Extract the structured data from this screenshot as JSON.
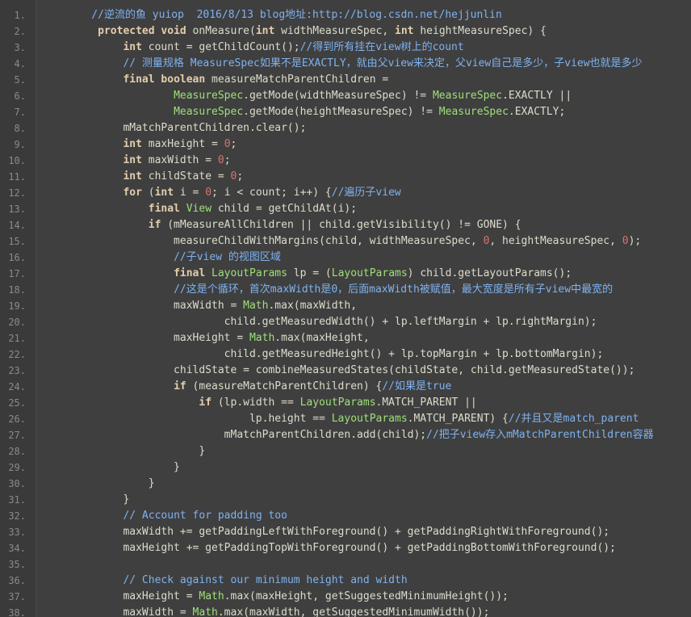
{
  "colors": {
    "background": "#3f3f3f",
    "gutter": "#3a3a3a",
    "line_number": "#8a8a8a",
    "plain": "#dcdccc",
    "keyword": "#e3ceab",
    "comment": "#7fb2ef",
    "type": "#9fe07a",
    "number": "#d5736f"
  },
  "lines": [
    {
      "n": "1.",
      "tokens": [
        [
          "cm",
          "    //逆流的鱼 yuiop  2016/8/13 blog地址:http://blog.csdn.net/hejjunlin"
        ]
      ]
    },
    {
      "n": "2.",
      "tokens": [
        [
          "pl",
          "     "
        ],
        [
          "kw",
          "protected"
        ],
        [
          "pl",
          " "
        ],
        [
          "kw",
          "void"
        ],
        [
          "pl",
          " onMeasure("
        ],
        [
          "kw",
          "int"
        ],
        [
          "pl",
          " widthMeasureSpec, "
        ],
        [
          "kw",
          "int"
        ],
        [
          "pl",
          " heightMeasureSpec) {"
        ]
      ]
    },
    {
      "n": "3.",
      "tokens": [
        [
          "pl",
          "         "
        ],
        [
          "kw",
          "int"
        ],
        [
          "pl",
          " count = getChildCount();"
        ],
        [
          "cm",
          "//得到所有挂在view树上的count"
        ]
      ]
    },
    {
      "n": "4.",
      "tokens": [
        [
          "pl",
          "         "
        ],
        [
          "cm",
          "// 测量规格 MeasureSpec如果不是EXACTLY，就由父view来决定，父view自己是多少，子view也就是多少"
        ]
      ]
    },
    {
      "n": "5.",
      "tokens": [
        [
          "pl",
          "         "
        ],
        [
          "kw",
          "final"
        ],
        [
          "pl",
          " "
        ],
        [
          "kw",
          "boolean"
        ],
        [
          "pl",
          " measureMatchParentChildren ="
        ]
      ]
    },
    {
      "n": "6.",
      "tokens": [
        [
          "pl",
          "                 "
        ],
        [
          "ty",
          "MeasureSpec"
        ],
        [
          "pl",
          ".getMode(widthMeasureSpec) != "
        ],
        [
          "ty",
          "MeasureSpec"
        ],
        [
          "pl",
          ".EXACTLY ||"
        ]
      ]
    },
    {
      "n": "7.",
      "tokens": [
        [
          "pl",
          "                 "
        ],
        [
          "ty",
          "MeasureSpec"
        ],
        [
          "pl",
          ".getMode(heightMeasureSpec) != "
        ],
        [
          "ty",
          "MeasureSpec"
        ],
        [
          "pl",
          ".EXACTLY;"
        ]
      ]
    },
    {
      "n": "8.",
      "tokens": [
        [
          "pl",
          "         mMatchParentChildren.clear();"
        ]
      ]
    },
    {
      "n": "9.",
      "tokens": [
        [
          "pl",
          "         "
        ],
        [
          "kw",
          "int"
        ],
        [
          "pl",
          " maxHeight = "
        ],
        [
          "num",
          "0"
        ],
        [
          "pl",
          ";"
        ]
      ]
    },
    {
      "n": "10.",
      "tokens": [
        [
          "pl",
          "         "
        ],
        [
          "kw",
          "int"
        ],
        [
          "pl",
          " maxWidth = "
        ],
        [
          "num",
          "0"
        ],
        [
          "pl",
          ";"
        ]
      ]
    },
    {
      "n": "11.",
      "tokens": [
        [
          "pl",
          "         "
        ],
        [
          "kw",
          "int"
        ],
        [
          "pl",
          " childState = "
        ],
        [
          "num",
          "0"
        ],
        [
          "pl",
          ";"
        ]
      ]
    },
    {
      "n": "12.",
      "tokens": [
        [
          "pl",
          "         "
        ],
        [
          "kw",
          "for"
        ],
        [
          "pl",
          " ("
        ],
        [
          "kw",
          "int"
        ],
        [
          "pl",
          " i = "
        ],
        [
          "num",
          "0"
        ],
        [
          "pl",
          "; i < count; i++) {"
        ],
        [
          "cm",
          "//遍历子view"
        ]
      ]
    },
    {
      "n": "13.",
      "tokens": [
        [
          "pl",
          "             "
        ],
        [
          "kw",
          "final"
        ],
        [
          "pl",
          " "
        ],
        [
          "ty",
          "View"
        ],
        [
          "pl",
          " child = getChildAt(i);"
        ]
      ]
    },
    {
      "n": "14.",
      "tokens": [
        [
          "pl",
          "             "
        ],
        [
          "kw",
          "if"
        ],
        [
          "pl",
          " (mMeasureAllChildren || child.getVisibility() != GONE) {"
        ]
      ]
    },
    {
      "n": "15.",
      "tokens": [
        [
          "pl",
          "                 measureChildWithMargins(child, widthMeasureSpec, "
        ],
        [
          "num",
          "0"
        ],
        [
          "pl",
          ", heightMeasureSpec, "
        ],
        [
          "num",
          "0"
        ],
        [
          "pl",
          ");"
        ]
      ]
    },
    {
      "n": "16.",
      "tokens": [
        [
          "pl",
          "                 "
        ],
        [
          "cm",
          "//子view 的视图区域"
        ]
      ]
    },
    {
      "n": "17.",
      "tokens": [
        [
          "pl",
          "                 "
        ],
        [
          "kw",
          "final"
        ],
        [
          "pl",
          " "
        ],
        [
          "ty",
          "LayoutParams"
        ],
        [
          "pl",
          " lp = ("
        ],
        [
          "ty",
          "LayoutParams"
        ],
        [
          "pl",
          ") child.getLayoutParams();"
        ]
      ]
    },
    {
      "n": "18.",
      "tokens": [
        [
          "pl",
          "                 "
        ],
        [
          "cm",
          "//这是个循环，首次maxWidth是0，后面maxWidth被赋值，最大宽度是所有子view中最宽的"
        ]
      ]
    },
    {
      "n": "19.",
      "tokens": [
        [
          "pl",
          "                 maxWidth = "
        ],
        [
          "ty",
          "Math"
        ],
        [
          "pl",
          ".max(maxWidth,"
        ]
      ]
    },
    {
      "n": "20.",
      "tokens": [
        [
          "pl",
          "                         child.getMeasuredWidth() + lp.leftMargin + lp.rightMargin);"
        ]
      ]
    },
    {
      "n": "21.",
      "tokens": [
        [
          "pl",
          "                 maxHeight = "
        ],
        [
          "ty",
          "Math"
        ],
        [
          "pl",
          ".max(maxHeight,"
        ]
      ]
    },
    {
      "n": "22.",
      "tokens": [
        [
          "pl",
          "                         child.getMeasuredHeight() + lp.topMargin + lp.bottomMargin);"
        ]
      ]
    },
    {
      "n": "23.",
      "tokens": [
        [
          "pl",
          "                 childState = combineMeasuredStates(childState, child.getMeasuredState());"
        ]
      ]
    },
    {
      "n": "24.",
      "tokens": [
        [
          "pl",
          "                 "
        ],
        [
          "kw",
          "if"
        ],
        [
          "pl",
          " (measureMatchParentChildren) {"
        ],
        [
          "cm",
          "//如果是true"
        ]
      ]
    },
    {
      "n": "25.",
      "tokens": [
        [
          "pl",
          "                     "
        ],
        [
          "kw",
          "if"
        ],
        [
          "pl",
          " (lp.width == "
        ],
        [
          "ty",
          "LayoutParams"
        ],
        [
          "pl",
          ".MATCH_PARENT ||"
        ]
      ]
    },
    {
      "n": "26.",
      "tokens": [
        [
          "pl",
          "                             lp.height == "
        ],
        [
          "ty",
          "LayoutParams"
        ],
        [
          "pl",
          ".MATCH_PARENT) {"
        ],
        [
          "cm",
          "//并且又是match_parent"
        ]
      ]
    },
    {
      "n": "27.",
      "tokens": [
        [
          "pl",
          "                         mMatchParentChildren.add(child);"
        ],
        [
          "cm",
          "//把子view存入mMatchParentChildren容器"
        ]
      ]
    },
    {
      "n": "28.",
      "tokens": [
        [
          "pl",
          "                     }"
        ]
      ]
    },
    {
      "n": "29.",
      "tokens": [
        [
          "pl",
          "                 }"
        ]
      ]
    },
    {
      "n": "30.",
      "tokens": [
        [
          "pl",
          "             }"
        ]
      ]
    },
    {
      "n": "31.",
      "tokens": [
        [
          "pl",
          "         }"
        ]
      ]
    },
    {
      "n": "32.",
      "tokens": [
        [
          "pl",
          "         "
        ],
        [
          "cm",
          "// Account for padding too"
        ]
      ]
    },
    {
      "n": "33.",
      "tokens": [
        [
          "pl",
          "         maxWidth += getPaddingLeftWithForeground() + getPaddingRightWithForeground();"
        ]
      ]
    },
    {
      "n": "34.",
      "tokens": [
        [
          "pl",
          "         maxHeight += getPaddingTopWithForeground() + getPaddingBottomWithForeground();"
        ]
      ]
    },
    {
      "n": "35.",
      "tokens": [
        [
          "pl",
          ""
        ]
      ]
    },
    {
      "n": "36.",
      "tokens": [
        [
          "pl",
          "         "
        ],
        [
          "cm",
          "// Check against our minimum height and width"
        ]
      ]
    },
    {
      "n": "37.",
      "tokens": [
        [
          "pl",
          "         maxHeight = "
        ],
        [
          "ty",
          "Math"
        ],
        [
          "pl",
          ".max(maxHeight, getSuggestedMinimumHeight());"
        ]
      ]
    },
    {
      "n": "38.",
      "tokens": [
        [
          "pl",
          "         maxWidth = "
        ],
        [
          "ty",
          "Math"
        ],
        [
          "pl",
          ".max(maxWidth, getSuggestedMinimumWidth());"
        ]
      ]
    }
  ]
}
